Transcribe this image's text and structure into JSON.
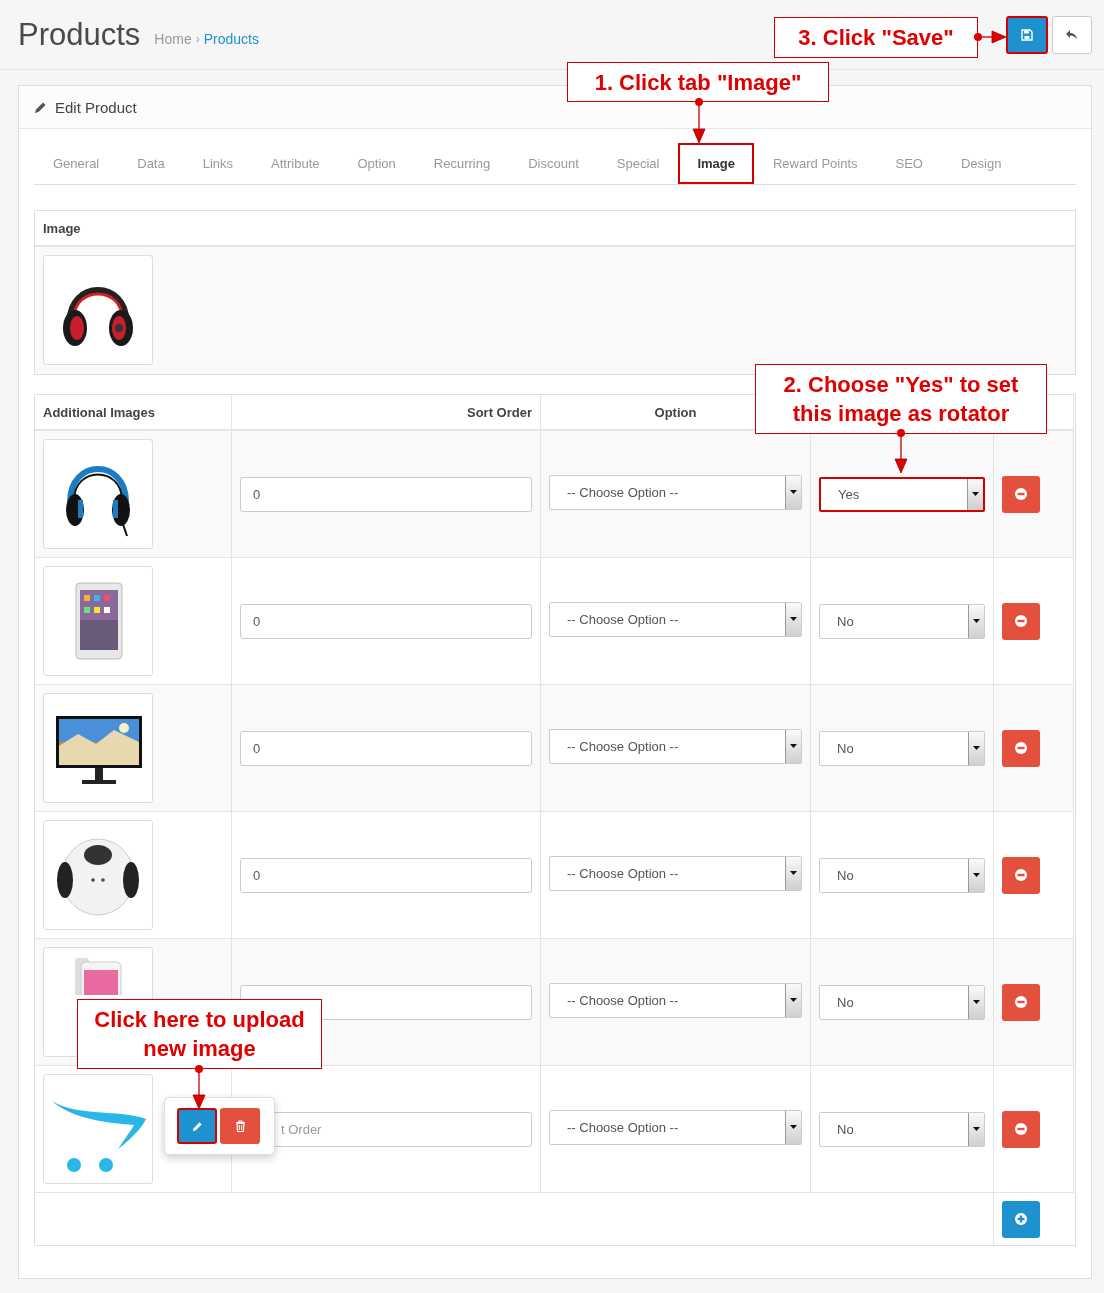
{
  "page": {
    "title": "Products",
    "breadcrumb": [
      {
        "label": "Home",
        "separator": "›",
        "selected": false
      },
      {
        "label": "Products",
        "selected": true
      }
    ]
  },
  "header_buttons": [
    {
      "kind": "save",
      "highlighted": true
    },
    {
      "kind": "back",
      "highlighted": false
    }
  ],
  "panel": {
    "title": "Edit Product"
  },
  "tabs": [
    {
      "label": "General",
      "selected": false,
      "highlighted": false
    },
    {
      "label": "Data",
      "selected": false,
      "highlighted": false
    },
    {
      "label": "Links",
      "selected": false,
      "highlighted": false
    },
    {
      "label": "Attribute",
      "selected": false,
      "highlighted": false
    },
    {
      "label": "Option",
      "selected": false,
      "highlighted": false
    },
    {
      "label": "Recurring",
      "selected": false,
      "highlighted": false
    },
    {
      "label": "Discount",
      "selected": false,
      "highlighted": false
    },
    {
      "label": "Special",
      "selected": false,
      "highlighted": false
    },
    {
      "label": "Image",
      "selected": true,
      "highlighted": true
    },
    {
      "label": "Reward Points",
      "selected": false,
      "highlighted": false
    },
    {
      "label": "SEO",
      "selected": false,
      "highlighted": false
    },
    {
      "label": "Design",
      "selected": false,
      "highlighted": false
    }
  ],
  "image_section": {
    "heading": "Image"
  },
  "additional_images": {
    "columns": [
      "Additional Images",
      "Sort Order",
      "Option"
    ],
    "rows": [
      {
        "sort_order": "0",
        "option": "-- Choose Option --",
        "rotator": "Yes",
        "highlighted": true
      },
      {
        "sort_order": "0",
        "option": "-- Choose Option --",
        "rotator": "No",
        "highlighted": false
      },
      {
        "sort_order": "0",
        "option": "-- Choose Option --",
        "rotator": "No",
        "highlighted": false
      },
      {
        "sort_order": "0",
        "option": "-- Choose Option --",
        "rotator": "No",
        "highlighted": false
      },
      {
        "option": "-- Choose Option --",
        "rotator": "No",
        "highlighted": false
      },
      {
        "placeholder": "t Order",
        "option": "-- Choose Option --",
        "rotator": "No",
        "highlighted": false
      }
    ]
  },
  "popover_buttons": [
    {
      "kind": "edit",
      "highlighted": true
    },
    {
      "kind": "delete",
      "highlighted": false
    }
  ],
  "callouts": [
    {
      "text": "3. Click \"Save\""
    },
    {
      "text": "1. Click tab \"Image\""
    },
    {
      "text": "2. Choose \"Yes\" to set this image as rotator"
    },
    {
      "text": "Click here to upload new image"
    }
  ]
}
